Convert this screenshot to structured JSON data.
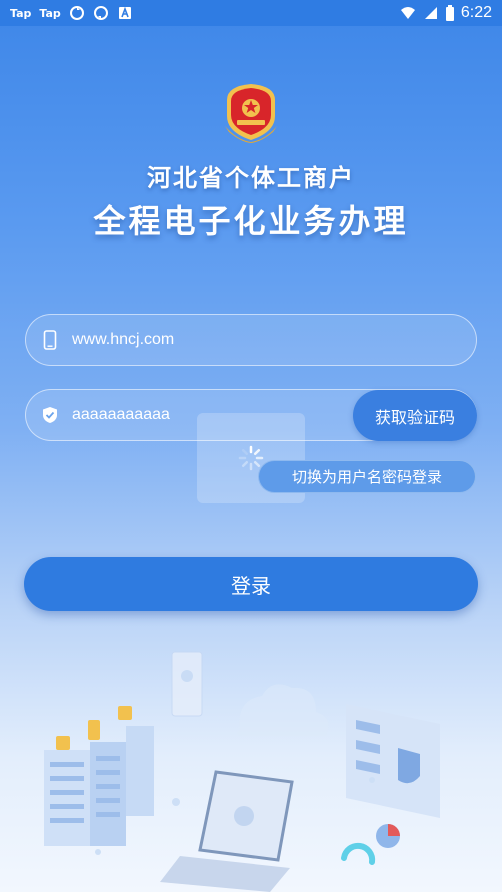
{
  "status_bar": {
    "left_badges": [
      "Tap",
      "Tap"
    ],
    "time": "6:22",
    "icons": [
      "tap-app-icon",
      "tap-app-icon",
      "sync-icon",
      "sync-icon",
      "a-icon",
      "wifi-icon",
      "signal-icon",
      "battery-icon"
    ]
  },
  "header": {
    "title_line1": "河北省个体工商户",
    "title_line2": "全程电子化业务办理"
  },
  "form": {
    "phone_value": "www.hncj.com",
    "code_value": "aaaaaaaaaaa",
    "get_code_label": "获取验证码",
    "switch_label": "切换为用户名密码登录",
    "login_label": "登录"
  },
  "colors": {
    "primary": "#2f7be0",
    "background_top": "#3d86e8",
    "emblem_red": "#d8252a",
    "emblem_gold": "#f2c14e"
  }
}
